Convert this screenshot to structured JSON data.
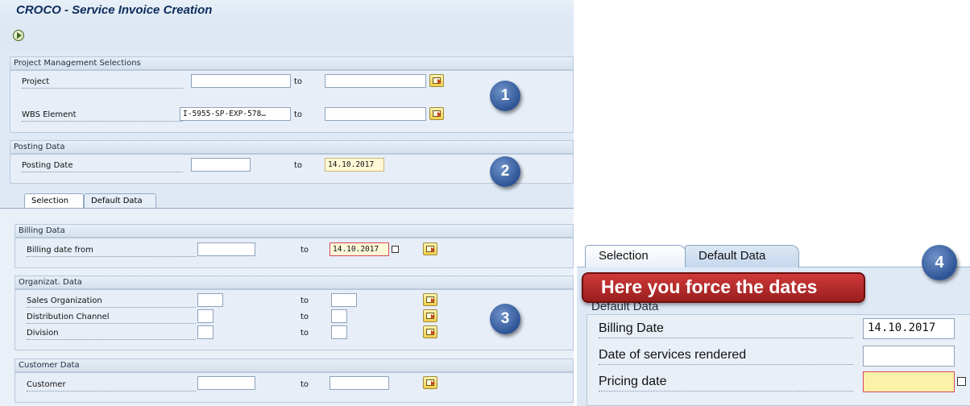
{
  "window": {
    "title": "CROCO - Service Invoice Creation"
  },
  "toolbar": {
    "execute_icon": "execute-icon"
  },
  "project_mgmt": {
    "header": "Project Management Selections",
    "rows": [
      {
        "label": "Project",
        "from": "",
        "to_label": "to",
        "to": ""
      },
      {
        "label": "WBS Element",
        "from": "I-5955-SP-EXP-578…",
        "to_label": "to",
        "to": ""
      }
    ]
  },
  "posting": {
    "header": "Posting Data",
    "rows": [
      {
        "label": "Posting Date",
        "from": "",
        "to_label": "to",
        "to": "14.10.2017"
      }
    ]
  },
  "tabs": [
    {
      "label": "Selection",
      "active": true
    },
    {
      "label": "Default Data",
      "active": false
    }
  ],
  "billing": {
    "header": "Billing Data",
    "rows": [
      {
        "label": "Billing date from",
        "from": "",
        "to_label": "to",
        "to": "14.10.2017"
      }
    ]
  },
  "org": {
    "header": "Organizat. Data",
    "rows": [
      {
        "label": "Sales Organization",
        "from": "",
        "to_label": "to",
        "to": ""
      },
      {
        "label": "Distribution Channel",
        "from": "",
        "to_label": "to",
        "to": ""
      },
      {
        "label": "Division",
        "from": "",
        "to_label": "to",
        "to": ""
      }
    ]
  },
  "customer": {
    "header": "Customer Data",
    "rows": [
      {
        "label": "Customer",
        "from": "",
        "to_label": "to",
        "to": ""
      }
    ]
  },
  "badges": [
    "1",
    "2",
    "3",
    "4"
  ],
  "zoom": {
    "tabs": [
      "Selection",
      "Default Data"
    ],
    "banner": "Here you force the dates",
    "group_title": "Default Data",
    "rows": [
      {
        "label": "Billing Date",
        "value": "14.10.2017"
      },
      {
        "label": "Date of services rendered",
        "value": ""
      },
      {
        "label": "Pricing date",
        "value": ""
      }
    ]
  },
  "colors": {
    "background": "#dfe9f5",
    "badge": "#2e5496",
    "banner": "#b52a2a",
    "required_field": "#fff8d6"
  }
}
